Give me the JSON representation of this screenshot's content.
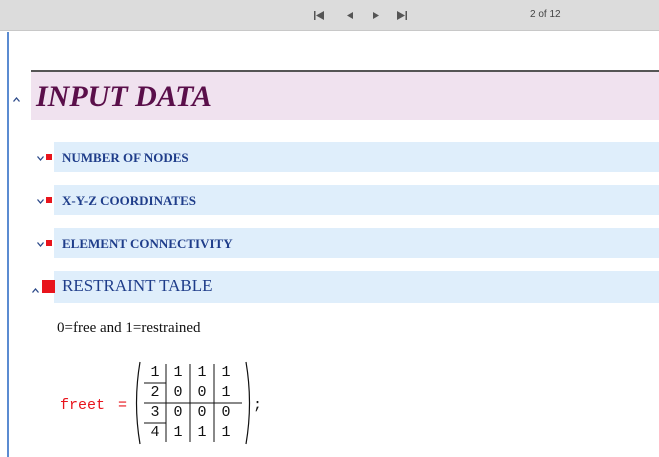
{
  "toolbar": {
    "nav": {
      "first": "⏮",
      "prev": "◀",
      "next": "▶",
      "last": "⏭"
    },
    "page_indicator": "2 of 12"
  },
  "sections": {
    "input_data": {
      "title": "INPUT DATA"
    },
    "number_of_nodes": {
      "label": "NUMBER OF NODES"
    },
    "xyz_coordinates": {
      "label": "X-Y-Z COORDINATES"
    },
    "element_connectivity": {
      "label": "ELEMENT CONNECTIVITY"
    },
    "restraint_table": {
      "label": "RESTRAINT TABLE"
    }
  },
  "content": {
    "note": "0=free  and  1=restrained",
    "variable_name": "freet",
    "equals": "=",
    "terminator": ";",
    "matrix": [
      [
        "1",
        "1",
        "1",
        "1"
      ],
      [
        "2",
        "0",
        "0",
        "1"
      ],
      [
        "3",
        "0",
        "0",
        "0"
      ],
      [
        "4",
        "1",
        "1",
        "1"
      ]
    ]
  },
  "colors": {
    "toolbar_bg": "#dcdcdc",
    "section_bg": "#dfeefb",
    "title_bg": "#f0e2ef",
    "title_text": "#5a0f4a",
    "section_text": "#1f3d8a",
    "marker_red": "#e8141c"
  },
  "icons": {
    "collapse": "caret-up-icon",
    "expand": "caret-down-icon",
    "marker": "red-square-icon"
  }
}
